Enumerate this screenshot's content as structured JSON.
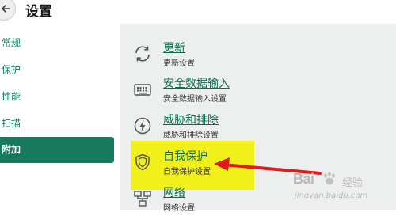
{
  "header": {
    "title": "设置"
  },
  "sidebar": {
    "items": [
      {
        "label": "常规"
      },
      {
        "label": "保护"
      },
      {
        "label": "性能"
      },
      {
        "label": "扫描"
      },
      {
        "label": "附加",
        "active": true
      }
    ]
  },
  "main": {
    "items": [
      {
        "title": "更新",
        "subtitle": "更新设置",
        "icon": "refresh-icon"
      },
      {
        "title": "安全数据输入",
        "subtitle": "安全数据输入设置",
        "icon": "keyboard-icon"
      },
      {
        "title": "威胁和排除",
        "subtitle": "威胁和排除设置",
        "icon": "lightning-icon"
      },
      {
        "title": "自我保护",
        "subtitle": "自我保护设置",
        "icon": "shield-icon",
        "highlighted": true
      },
      {
        "title": "网络",
        "subtitle": "网络设置",
        "icon": "network-icon"
      }
    ]
  },
  "watermark": {
    "brand": "Bai",
    "suffix": "经验",
    "url": "jingyan.baidu.com"
  },
  "colors": {
    "accent": "#177a5c",
    "link": "#0a6f52",
    "highlight": "#f2f01a",
    "arrow": "#e01b1b",
    "panel": "#edefee"
  }
}
